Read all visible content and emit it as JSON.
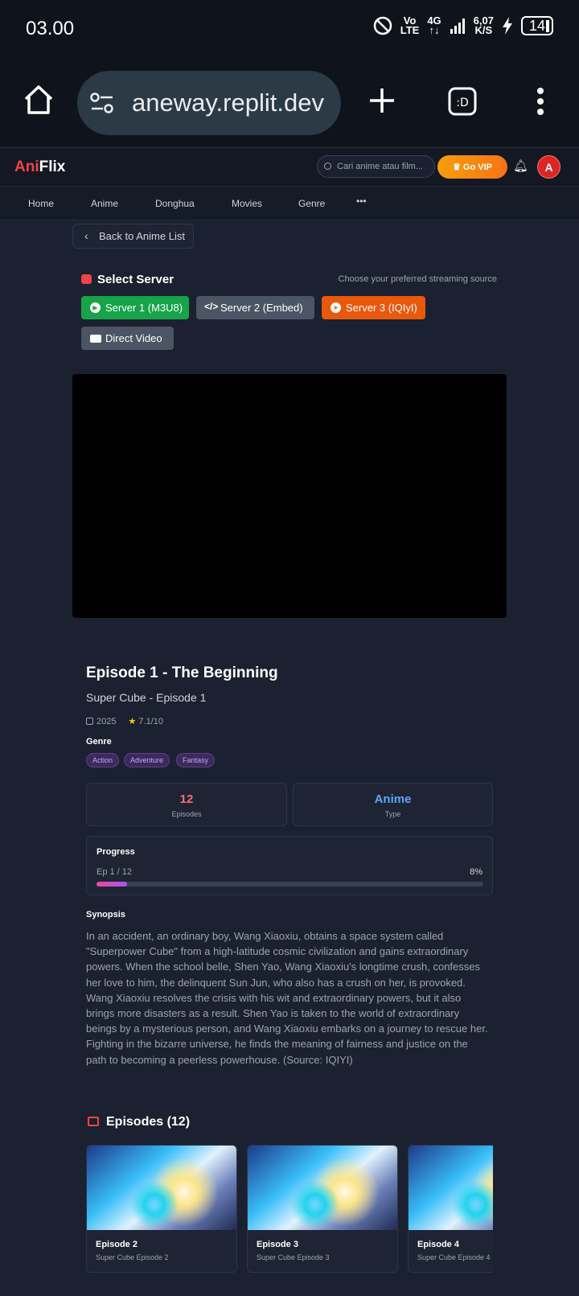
{
  "status_bar": {
    "time": "03.00",
    "net_top": "Vo",
    "net_bottom": "LTE",
    "gen_top": "4G",
    "gen_bottom": "↑↓",
    "speed_top": "6,07",
    "speed_bottom": "K/S",
    "battery": "14"
  },
  "browser": {
    "url": "aneway.replit.dev"
  },
  "header": {
    "logo_accent": "Ani",
    "logo_rest": "Flix",
    "search_placeholder": "Cari anime atau film...",
    "vip_label": "Go VIP",
    "avatar_initial": "A"
  },
  "nav": {
    "items": [
      "Home",
      "Anime",
      "Donghua",
      "Movies",
      "Genre"
    ],
    "more": "•••"
  },
  "back_label": "Back to Anime List",
  "server": {
    "title": "Select Server",
    "hint": "Choose your preferred streaming source",
    "buttons": [
      {
        "label": "Server 1 (M3U8)",
        "color": "#16a34a"
      },
      {
        "label": "Server 2 (Embed)",
        "color": "#4b5563"
      },
      {
        "label": "Server 3 (IQIyI)",
        "color": "#ea580c"
      },
      {
        "label": "Direct Video",
        "color": "#4b5563"
      }
    ]
  },
  "episode": {
    "title": "Episode 1 - The Beginning",
    "subtitle": "Super Cube - Episode 1",
    "year": "2025",
    "rating": "7.1/10",
    "genre_label": "Genre",
    "genres": [
      "Action",
      "Adventure",
      "Fantasy"
    ],
    "stats": [
      {
        "value": "12",
        "label": "Episodes",
        "color": "#f87171"
      },
      {
        "value": "Anime",
        "label": "Type",
        "color": "#60a5fa"
      }
    ],
    "progress": {
      "label": "Progress",
      "episode_text": "Ep 1 / 12",
      "percent_text": "8%",
      "fraction": 0.08
    },
    "synopsis_label": "Synopsis",
    "synopsis": "In an accident, an ordinary boy, Wang Xiaoxiu, obtains a space system called \"Superpower Cube\" from a high-latitude cosmic civilization and gains extraordinary powers. When the school belle, Shen Yao, Wang Xiaoxiu's longtime crush, confesses her love to him, the delinquent Sun Jun, who also has a crush on her, is provoked. Wang Xiaoxiu resolves the crisis with his wit and extraordinary powers, but it also brings more disasters as a result. Shen Yao is taken to the world of extraordinary beings by a mysterious person, and Wang Xiaoxiu embarks on a journey to rescue her. Fighting in the bizarre universe, he finds the meaning of fairness and justice on the path to becoming a peerless powerhouse. (Source: IQIYI)"
  },
  "episodes_section": {
    "title": "Episodes (12)",
    "cards": [
      {
        "title": "Episode 2",
        "subtitle": "Super Cube Episode 2"
      },
      {
        "title": "Episode 3",
        "subtitle": "Super Cube Episode 3"
      },
      {
        "title": "Episode 4",
        "subtitle": "Super Cube Episode 4"
      }
    ]
  }
}
